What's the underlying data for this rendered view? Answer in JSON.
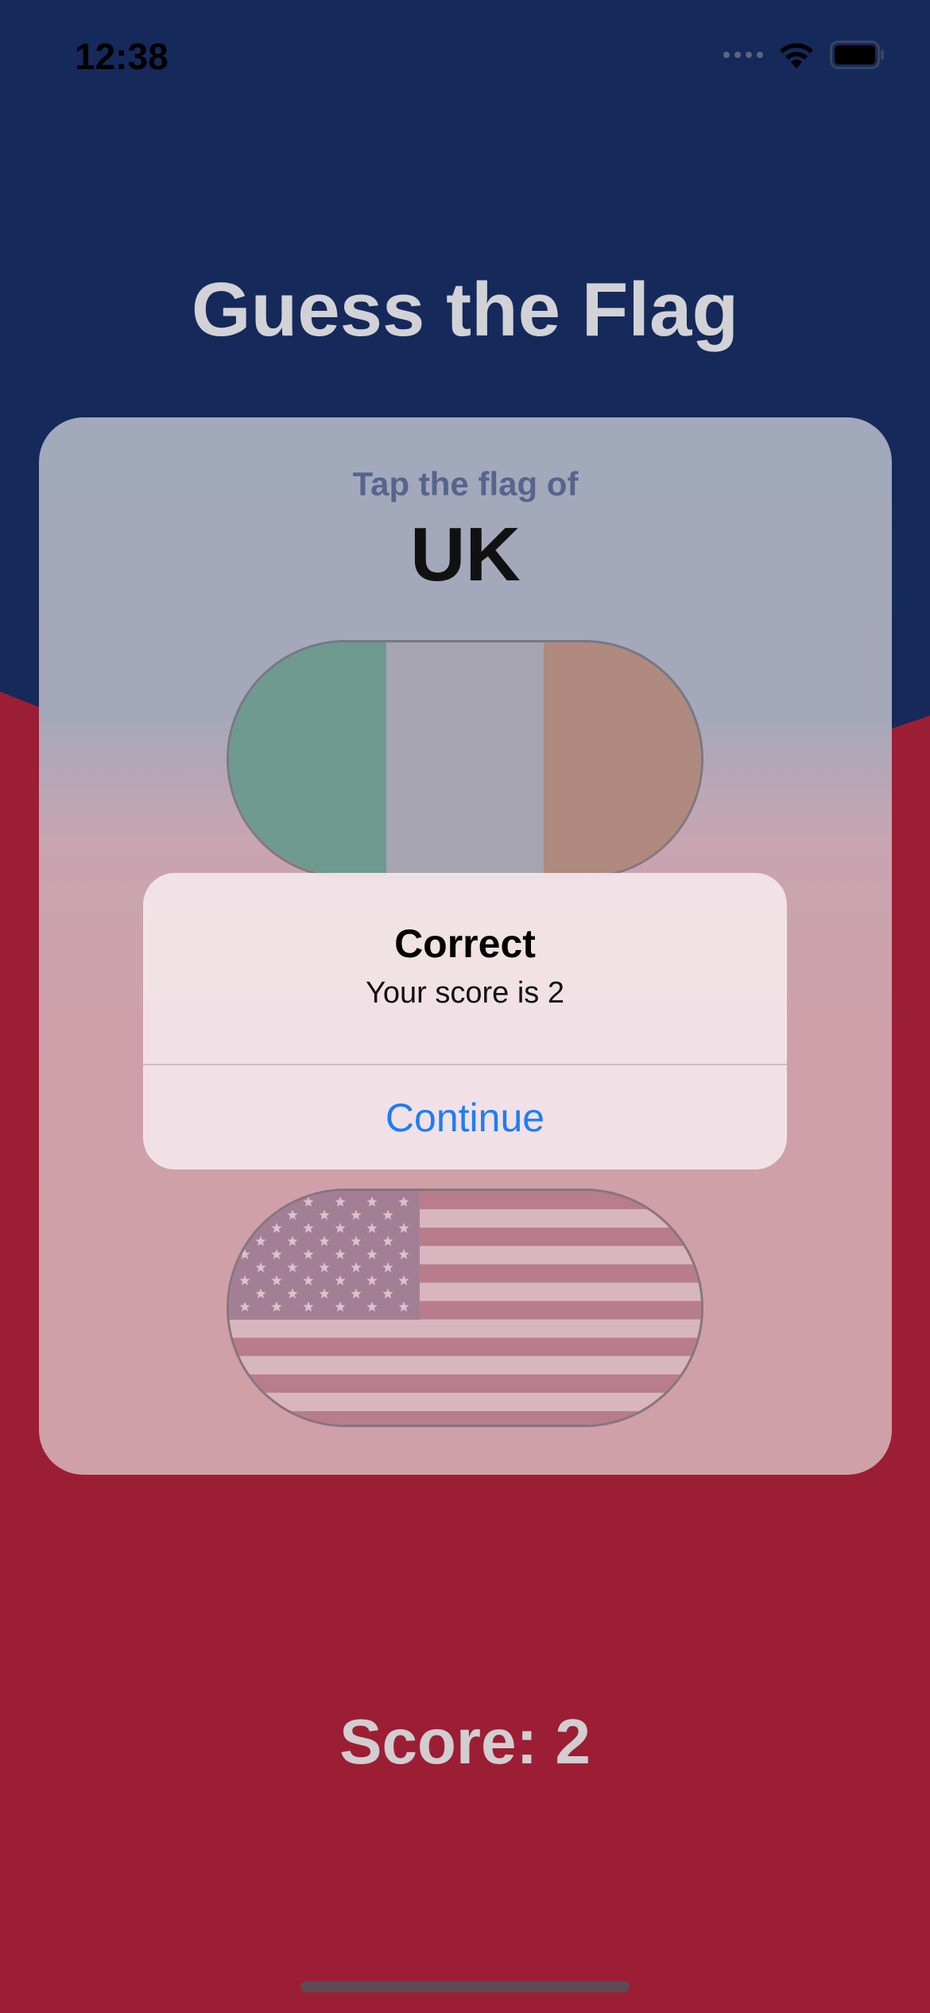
{
  "status_bar": {
    "time": "12:38",
    "icons": [
      "signal-icon",
      "wifi-icon",
      "battery-icon"
    ]
  },
  "app": {
    "title": "Guess the Flag",
    "prompt": "Tap the flag of",
    "country": "UK",
    "score_text": "Score: 2"
  },
  "flags": [
    {
      "name": "ireland-flag",
      "colors": [
        "#6f9a8f",
        "#a6a4b0",
        "#b0897f"
      ]
    },
    {
      "name": "usa-flag",
      "colors": [
        "#a37f95",
        "#b77d8c",
        "#d8b6bf"
      ]
    }
  ],
  "alert": {
    "title": "Correct",
    "message": "Your score is 2",
    "button_label": "Continue"
  },
  "colors": {
    "background_top": "#15295b",
    "background_bottom": "#9c1e34",
    "accent": "#1e7ef4"
  }
}
